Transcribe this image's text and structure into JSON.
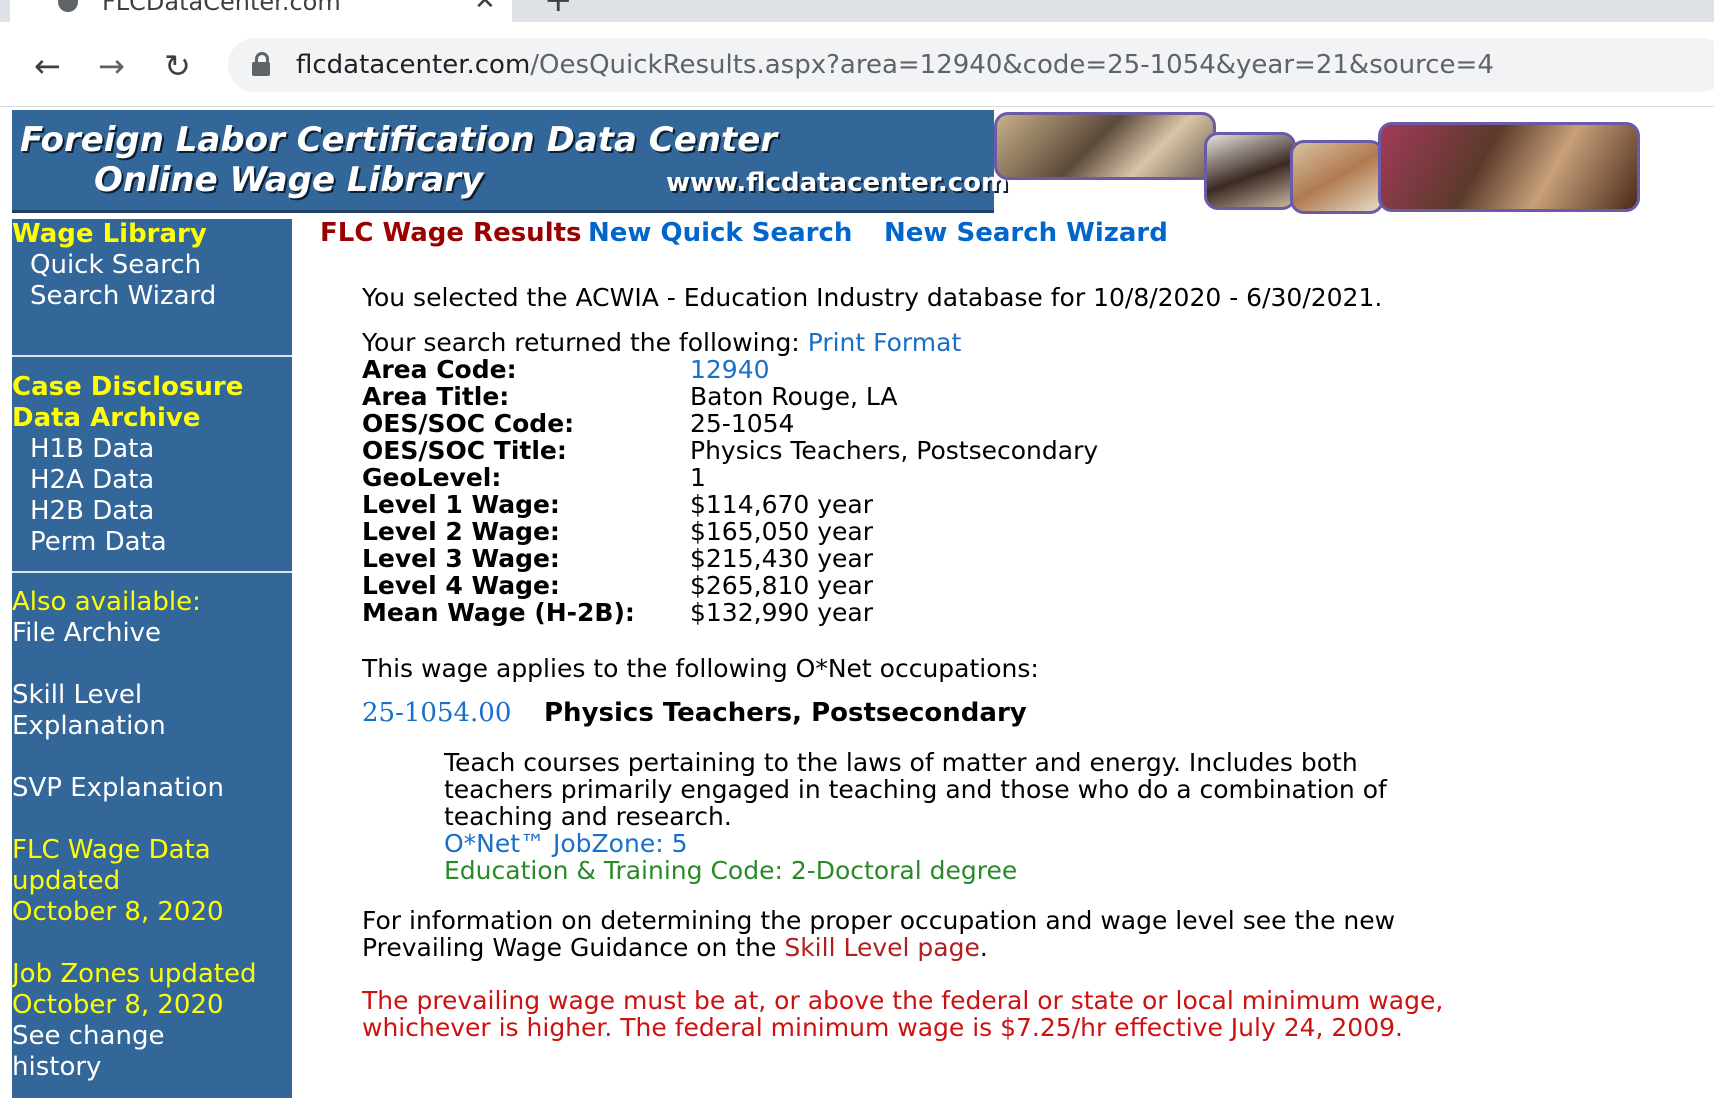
{
  "browser": {
    "tab_title": "FLCDataCenter.com",
    "url_host": "flcdatacenter.com",
    "url_path": "/OesQuickResults.aspx?area=12940&code=25-1054&year=21&source=4"
  },
  "banner": {
    "line1": "Foreign Labor Certification Data Center",
    "line2": "Online Wage Library",
    "site": "www.flcdatacenter.com"
  },
  "sidebar": {
    "wage_library": {
      "heading": "Wage Library",
      "links": [
        "Quick Search",
        "Search Wizard"
      ]
    },
    "case_disclosure": {
      "heading_line1": "Case Disclosure",
      "heading_line2": "Data Archive",
      "links": [
        "H1B Data",
        "H2A Data",
        "H2B Data",
        "Perm Data"
      ]
    },
    "also_available": "Also available:",
    "file_archive": "File Archive",
    "skill_level": [
      "Skill Level",
      "Explanation"
    ],
    "svp": "SVP Explanation",
    "flc_updated": [
      "FLC Wage Data",
      "updated",
      "October 8, 2020"
    ],
    "job_zones": [
      "Job Zones updated",
      "October 8, 2020"
    ],
    "change_history": [
      "See change",
      "history"
    ]
  },
  "main": {
    "results_title": "FLC Wage Results",
    "new_quick_search": "New Quick Search",
    "new_search_wizard": "New Search Wizard",
    "db_line": "You selected the ACWIA - Education Industry database for 10/8/2020 - 6/30/2021.",
    "returned_text": "Your search returned the following: ",
    "print_format": "Print Format",
    "fields": [
      {
        "label": "Area Code:",
        "value": "12940"
      },
      {
        "label": "Area Title:",
        "value": "Baton Rouge, LA"
      },
      {
        "label": "OES/SOC Code:",
        "value": "25-1054"
      },
      {
        "label": "OES/SOC Title:",
        "value": "Physics Teachers, Postsecondary"
      },
      {
        "label": "GeoLevel:",
        "value": "1"
      },
      {
        "label": "Level 1 Wage:",
        "value": "$114,670 year"
      },
      {
        "label": "Level 2 Wage:",
        "value": "$165,050 year"
      },
      {
        "label": "Level 3 Wage:",
        "value": "$215,430 year"
      },
      {
        "label": "Level 4 Wage:",
        "value": "$265,810 year"
      },
      {
        "label": "Mean Wage (H-2B):",
        "value": "$132,990 year"
      }
    ],
    "applies_text": "This wage applies to the following O*Net occupations:",
    "onet_code": "25-1054.00",
    "onet_title": "Physics Teachers, Postsecondary",
    "description": "Teach courses pertaining to the laws of matter and energy. Includes both teachers primarily engaged in teaching and those who do a combination of teaching and research.",
    "jobzone": "O*Net™ JobZone: 5",
    "education": "Education & Training Code: 2-Doctoral degree",
    "info_text_1": "For information on determining the proper occupation and wage level see the new Prevailing Wage Guidance on the ",
    "skill_level_link": "Skill Level page",
    "info_text_2": ".",
    "min_wage_notice": "The prevailing wage must be at, or above the federal or state or local minimum wage, whichever is higher. The federal minimum wage is $7.25/hr effective July 24, 2009."
  },
  "icons": {
    "back": "arrow-left",
    "forward": "arrow-right",
    "reload": "reload",
    "lock": "padlock",
    "tab_close": "x",
    "new_tab": "plus"
  },
  "colors": {
    "banner_blue": "#336699",
    "sidebar_heading": "#ffff00",
    "results_title": "#990000",
    "link_blue": "#0066cc",
    "notice_red": "#cc1111",
    "education_green": "#2a8a2a"
  }
}
